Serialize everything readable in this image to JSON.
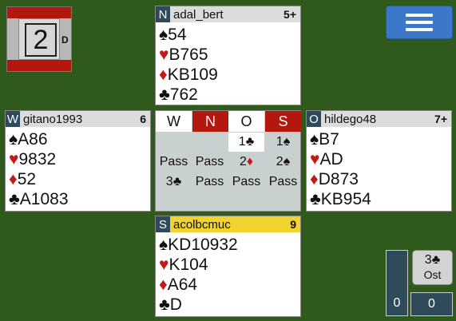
{
  "board": {
    "number": "2",
    "dealer": "D"
  },
  "menu": {
    "icon": "hamburger-menu-icon"
  },
  "north": {
    "seat": "N",
    "name": "adal_bert",
    "hcp": "5+",
    "spades": "54",
    "hearts": "B765",
    "diamonds": "KB109",
    "clubs": "762"
  },
  "west": {
    "seat": "W",
    "name": "gitano1993",
    "hcp": "6",
    "spades": "A86",
    "hearts": "9832",
    "diamonds": "52",
    "clubs": "A1083"
  },
  "east": {
    "seat": "O",
    "name": "hildego48",
    "hcp": "7+",
    "spades": "B7",
    "hearts": "AD",
    "diamonds": "D873",
    "clubs": "KB954"
  },
  "south": {
    "seat": "S",
    "name": "acolbcmuc",
    "hcp": "9",
    "spades": "KD10932",
    "hearts": "K104",
    "diamonds": "A64",
    "clubs": "D"
  },
  "suit_symbols": {
    "spades": "♠",
    "hearts": "♥",
    "diamonds": "♦",
    "clubs": "♣"
  },
  "bidding": {
    "headers": [
      "W",
      "N",
      "O",
      "S"
    ],
    "bids": {
      "r1_o": "1♣",
      "r1_s": "1♠",
      "r2_w": "Pass",
      "r2_n": "Pass",
      "r2_o_level": "2",
      "r2_o_suit": "♦",
      "r2_s": "2♠",
      "r3_w": "3♣",
      "r3_n": "Pass",
      "r3_o": "Pass",
      "r3_s": "Pass"
    }
  },
  "score": {
    "tricks_we": "0",
    "tricks_they": "0",
    "contract": "3♣",
    "declarer": "Ost"
  },
  "colors": {
    "felt": "#2f5a1c",
    "vulnerable": "#b3180f",
    "seat_badge": "#2f4a5a",
    "own_header": "#f2d22e",
    "red_suit": "#c21a1a",
    "menu": "#3b78c9"
  }
}
